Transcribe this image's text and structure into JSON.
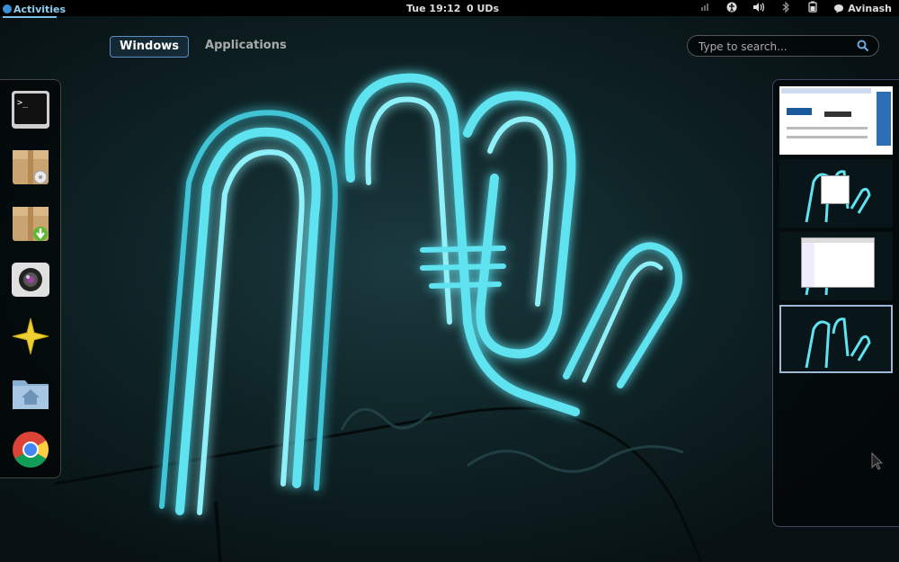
{
  "topbar": {
    "activities": "Activities",
    "clock": "Tue 19:12",
    "uds": "0 UDs",
    "user": "Avinash",
    "tray_icons": [
      "network-icon",
      "accessibility-icon",
      "volume-icon",
      "bluetooth-icon",
      "battery-icon"
    ]
  },
  "overview": {
    "tabs": [
      {
        "label": "Windows",
        "active": true
      },
      {
        "label": "Applications",
        "active": false
      }
    ],
    "search": {
      "placeholder": "Type to search..."
    }
  },
  "dash": {
    "items": [
      "terminal-icon",
      "archive-manager-icon",
      "software-installer-icon",
      "camera-icon",
      "star-icon",
      "home-folder-icon",
      "chrome-icon"
    ]
  },
  "workspaces": {
    "count": 4,
    "active_index": 3
  },
  "colors": {
    "neon": "#5fe3f0",
    "accent": "#5b8fbf",
    "topbar": "#000000"
  }
}
